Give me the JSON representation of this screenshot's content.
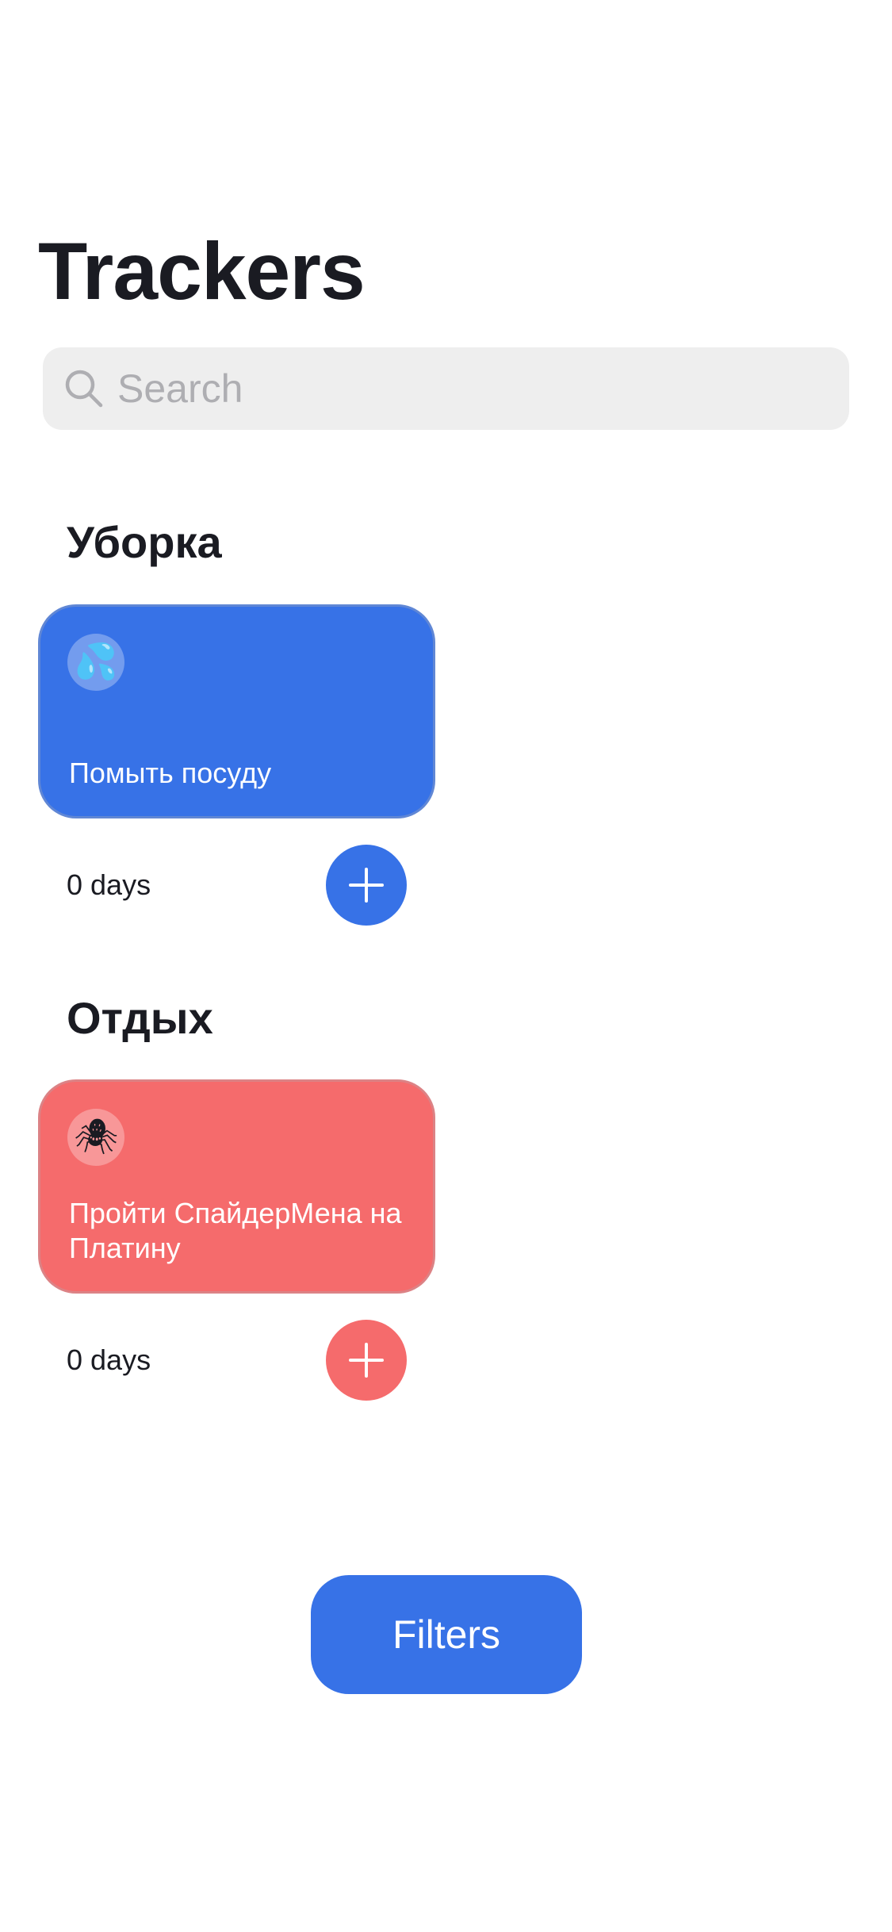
{
  "header": {
    "title": "Trackers"
  },
  "search": {
    "placeholder": "Search",
    "value": ""
  },
  "categories": [
    {
      "title": "Уборка",
      "color": "#3772e7",
      "trackers": [
        {
          "emoji": "💦",
          "icon": "sweat-droplets-icon",
          "name": "Помыть посуду",
          "days": "0 days"
        }
      ]
    },
    {
      "title": "Отдых",
      "color": "#f56b6c",
      "trackers": [
        {
          "emoji": "🕷",
          "icon": "spider-icon",
          "name": "Пройти СпайдерМена на Платину",
          "days": "0 days"
        }
      ]
    }
  ],
  "filters": {
    "label": "Filters",
    "color": "#3772e7"
  }
}
